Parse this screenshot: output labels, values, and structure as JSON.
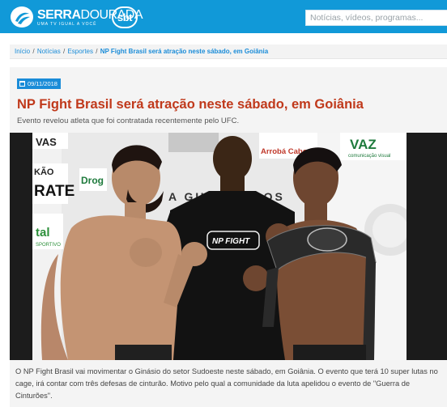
{
  "header": {
    "brand_name_bold": "SERRA",
    "brand_name_light": "DOURADA",
    "tagline": "UMA TV IGUAL A VOCÊ",
    "network_logo": "sbt",
    "search_placeholder": "Notícias, vídeos, programas..."
  },
  "breadcrumb": {
    "items": [
      "Início",
      "Notícias",
      "Esportes"
    ],
    "separator": "/",
    "current": "NP Fight Brasil será atração neste sábado, em Goiânia"
  },
  "article": {
    "date": "09/11/2018",
    "title": "NP Fight Brasil será atração neste sábado, em Goiânia",
    "subtitle": "Evento revelou atleta que foi contratada recentemente pelo UFC.",
    "body": "O NP Fight Brasil vai movimentar o Ginásio do setor Sudoeste neste sábado, em Goiânia. O evento que terá 10 super lutas no cage, irá contar com três defesas de cinturão. Motivo pelo qual a comunidade da luta apelidou o evento de \"Guerra de Cinturões\"."
  },
  "photo": {
    "banner_texts": [
      "VAS",
      "KÃO",
      "RATE",
      "Drog",
      "Arrobá Cabo",
      "VAZ",
      "comunicação visual",
      "A GUERRA DOS",
      "tal",
      "SPORTIVO"
    ],
    "shirt_logo": "NP FIGHT"
  },
  "colors": {
    "header_blue": "#1199d8",
    "link_blue": "#1a8cd8",
    "title_red": "#c0391b"
  },
  "icons": [
    "serra-dourada-logo-icon",
    "sbt-logo-icon",
    "calendar-icon"
  ]
}
